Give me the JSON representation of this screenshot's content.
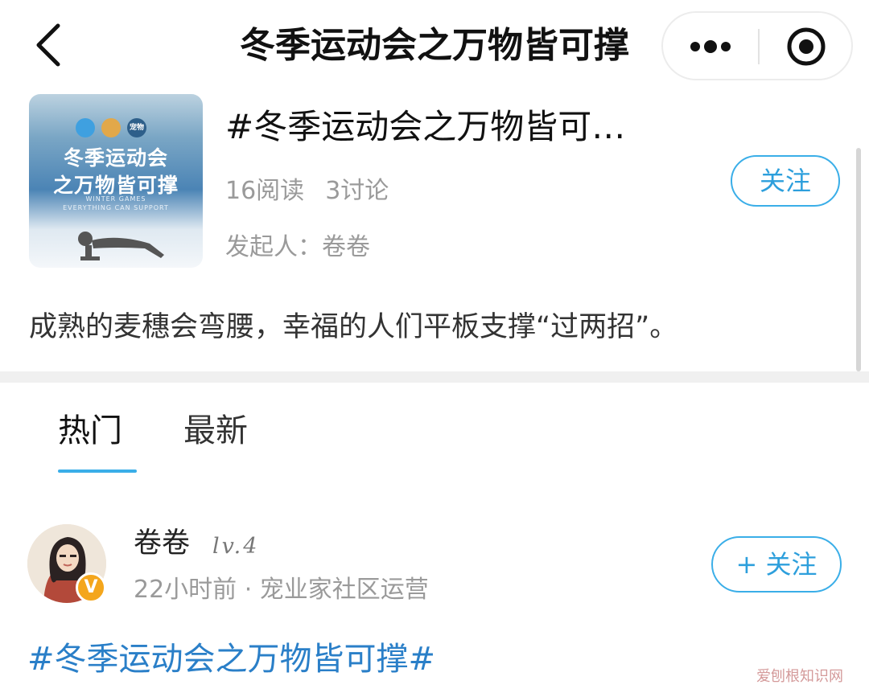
{
  "nav": {
    "title": "冬季运动会之万物皆可撑",
    "back_icon": "chevron-left-icon",
    "more_icon": "more-dots-icon",
    "close_icon": "target-circle-icon"
  },
  "topic": {
    "cover": {
      "logos": [
        "",
        "",
        "宠物"
      ],
      "title_line1": "冬季运动会",
      "title_line2": "之万物皆可撑",
      "subtitle_line1": "WINTER GAMES",
      "subtitle_line2": "EVERYTHING CAN SUPPORT"
    },
    "title": "#冬季运动会之万物皆可…",
    "reads": "16阅读",
    "discussions": "3讨论",
    "owner": "发起人：卷卷",
    "follow_label": "关注",
    "description": "成熟的麦穗会弯腰，幸福的人们平板支撑“过两招”。"
  },
  "tabs": {
    "hot": "热门",
    "latest": "最新",
    "active": "hot"
  },
  "post": {
    "author": "卷卷",
    "level": "lv.4",
    "badge": "V",
    "meta": "22小时前 · 宠业家社区运营",
    "follow_label": "+ 关注",
    "hashtag": "#冬季运动会之万物皆可撑#"
  },
  "watermark": "爱刨根知识网",
  "colors": {
    "accent": "#3aaee8",
    "hashtag": "#2a7fc8",
    "muted": "#9a9a9a",
    "badge": "#f4a61c"
  }
}
